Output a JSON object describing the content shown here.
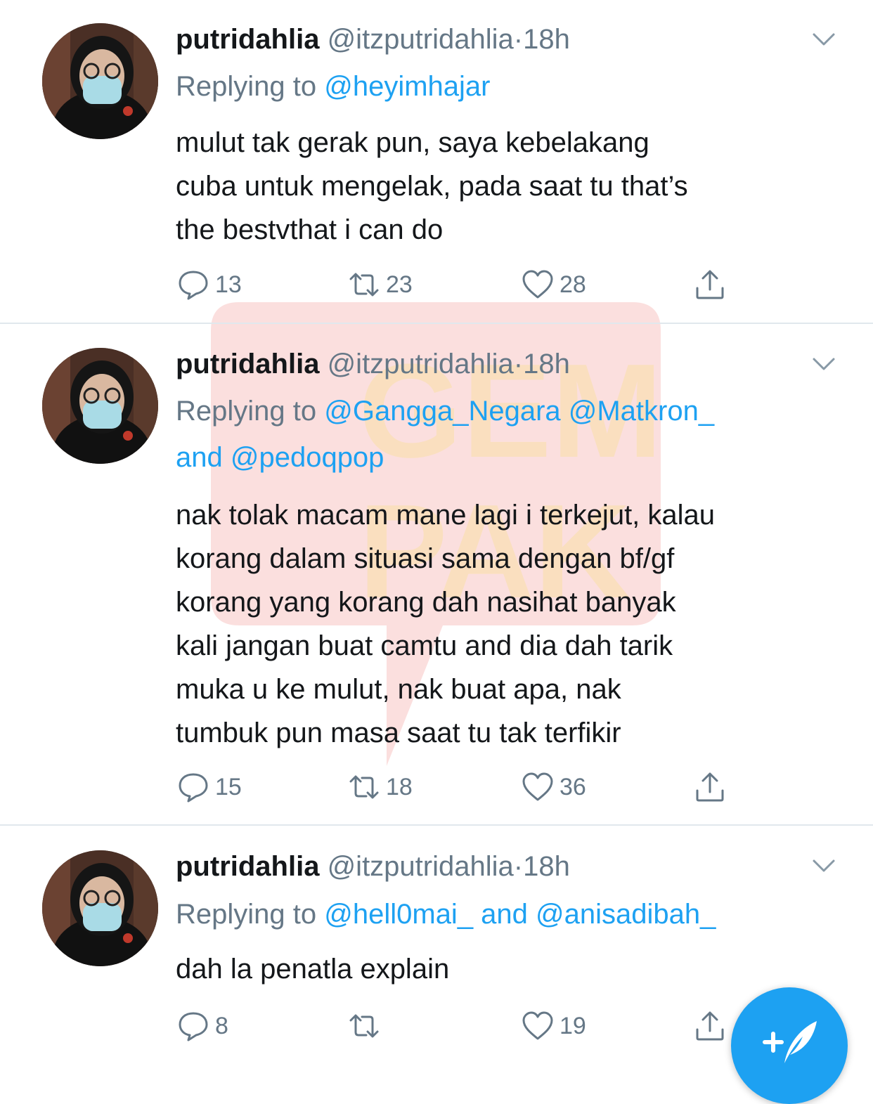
{
  "tweets": [
    {
      "name": "putridahlia",
      "handle": "@itzputridahlia",
      "dot": "·",
      "time": "18h",
      "replying_prefix": "Replying to",
      "mentions_line": "@heyimhajar",
      "mentions_line2": "",
      "text_lines": [
        "mulut tak gerak pun, saya kebelakang",
        "cuba untuk mengelak, pada saat tu that’s",
        "the bestvthat i can do"
      ],
      "replies": "13",
      "retweets": "23",
      "likes": "28"
    },
    {
      "name": "putridahlia",
      "handle": "@itzputridahlia",
      "dot": "·",
      "time": "18h",
      "replying_prefix": "Replying to",
      "mentions_line": "@Gangga_Negara @Matkron_",
      "mentions_line2": "and @pedoqpop",
      "text_lines": [
        "nak tolak macam mane lagi i terkejut, kalau",
        "korang dalam situasi sama dengan bf/gf",
        "korang yang korang dah nasihat banyak",
        "kali jangan buat camtu and dia dah tarik",
        "muka u ke mulut, nak buat apa, nak",
        "tumbuk pun masa saat tu tak terfikir"
      ],
      "replies": "15",
      "retweets": "18",
      "likes": "36"
    },
    {
      "name": "putridahlia",
      "handle": "@itzputridahlia",
      "dot": "·",
      "time": "18h",
      "replying_prefix": "Replying to",
      "mentions_line": "@hell0mai_ and @anisadibah_",
      "mentions_line2": "",
      "text_lines": [
        "dah la penatla explain"
      ],
      "replies": "8",
      "retweets": "",
      "likes": "19"
    }
  ],
  "watermark": {
    "text_top": "GEM",
    "text_bottom": "PAK",
    "color": "#e8322f"
  },
  "colors": {
    "accent": "#1da1f2",
    "muted": "#657786",
    "text": "#14171a",
    "divider": "#e1e8ed"
  },
  "icons": {
    "reply": "reply-icon",
    "retweet": "retweet-icon",
    "like": "heart-icon",
    "share": "share-icon",
    "menu": "chevron-down-icon",
    "compose": "compose-tweet-icon"
  }
}
